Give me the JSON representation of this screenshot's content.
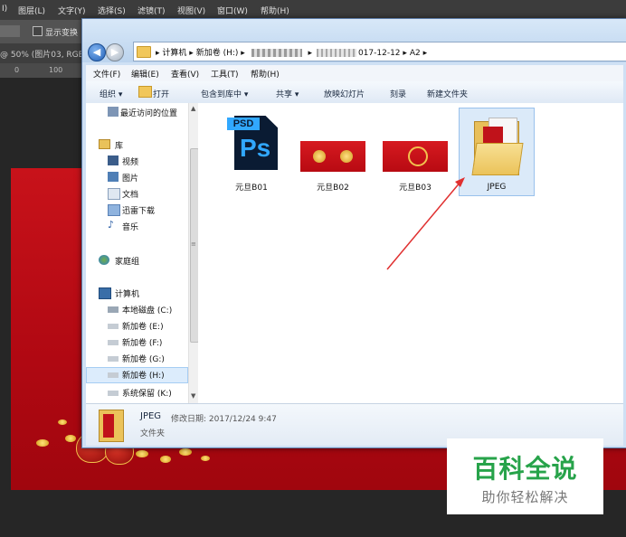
{
  "photoshop": {
    "menu": [
      "I)",
      "图层(L)",
      "文字(Y)",
      "选择(S)",
      "滤镜(T)",
      "视图(V)",
      "窗口(W)",
      "帮助(H)"
    ],
    "options_label": "显示变换",
    "doc_tab": "@ 50% (图片03, RGB",
    "ruler": [
      "0",
      "100"
    ]
  },
  "explorer": {
    "nav_back_glyph": "◀",
    "nav_fwd_glyph": "▶",
    "address": {
      "computer": "计算机",
      "drive": "新加卷 (H:)",
      "partial": "017-12-12",
      "folder": "A2",
      "sep": "▸"
    },
    "menu": [
      "文件(F)",
      "编辑(E)",
      "查看(V)",
      "工具(T)",
      "帮助(H)"
    ],
    "toolbar": {
      "organize": "组织 ▾",
      "open": "打开",
      "include": "包含到库中 ▾",
      "share": "共享 ▾",
      "slideshow": "放映幻灯片",
      "burn": "刻录",
      "new_folder": "新建文件夹"
    },
    "nav": {
      "recent": "最近访问的位置",
      "libraries": "库",
      "videos": "视频",
      "pictures": "图片",
      "documents": "文档",
      "thunder": "迅雷下载",
      "music": "音乐",
      "homegroup": "家庭组",
      "computer": "计算机",
      "local_c": "本地磁盘 (C:)",
      "drive_e": "新加卷 (E:)",
      "drive_f": "新加卷 (F:)",
      "drive_g": "新加卷 (G:)",
      "drive_h": "新加卷 (H:)",
      "drive_k": "系统保留 (K:)"
    },
    "files": [
      {
        "name": "元旦B01",
        "psd_tag": "PSD",
        "ps_text": "Ps"
      },
      {
        "name": "元旦B02"
      },
      {
        "name": "元旦B03"
      },
      {
        "name": "JPEG"
      }
    ],
    "details": {
      "name": "JPEG",
      "modified": "修改日期: 2017/12/24 9:47",
      "type": "文件夹"
    },
    "colors": {
      "selection": "#dbeaf9",
      "annotation_arrow": "#e03030"
    }
  },
  "watermark": {
    "title": "百科全说",
    "subtitle": "助你轻松解决"
  }
}
